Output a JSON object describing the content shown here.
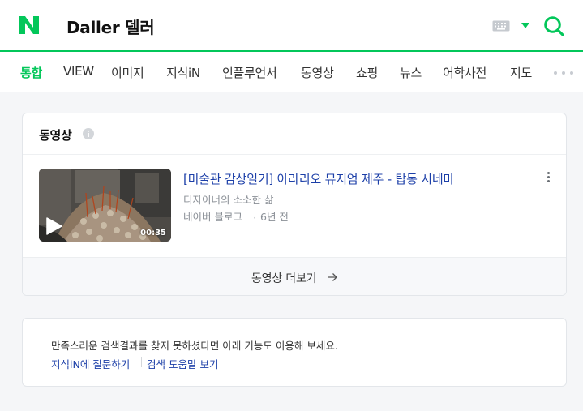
{
  "header": {
    "logo_letter": "N",
    "query": "Daller 델러"
  },
  "tabs": [
    {
      "label": "통합",
      "active": true
    },
    {
      "label": "VIEW"
    },
    {
      "label": "이미지"
    },
    {
      "label": "지식iN"
    },
    {
      "label": "인플루언서"
    },
    {
      "label": "동영상"
    },
    {
      "label": "쇼핑"
    },
    {
      "label": "뉴스"
    },
    {
      "label": "어학사전"
    },
    {
      "label": "지도"
    }
  ],
  "video_section": {
    "title": "동영상",
    "item": {
      "title": "[미술관 감상일기] 아라리오 뮤지엄 제주 - 탑동 시네마",
      "author": "디자이너의 소소한 삶",
      "source": "네이버 블로그",
      "separator": "·",
      "date": "6년 전",
      "duration": "00:35"
    },
    "more_label": "동영상 더보기"
  },
  "feedback": {
    "text": "만족스러운 검색결과를 찾지 못하셨다면 아래 기능도 이용해 보세요.",
    "link1": "지식iN에 질문하기",
    "link2": "검색 도움말 보기"
  },
  "colors": {
    "brand_green": "#03c75a",
    "link_blue": "#1c3fa8"
  }
}
